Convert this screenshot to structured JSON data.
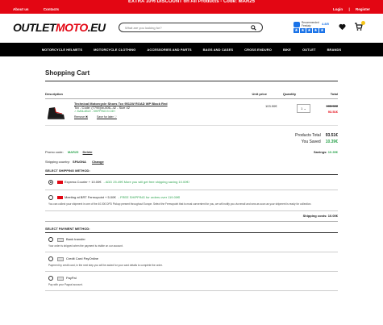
{
  "promo_bar": {
    "text": "EXTRA 10% DISCOUNT on All Products - Code: MAR25"
  },
  "top_bar": {
    "about": "About us",
    "contacts": "Contacts",
    "login": "Login",
    "sep": "|",
    "register": "Register"
  },
  "header": {
    "logo_outlet": "OUTLET",
    "logo_moto": "MOTO",
    "logo_eu": ".EU",
    "search_placeholder": "What are you looking for?",
    "rating_text": "Recommended Feedaty",
    "rating_score": "4.8/5"
  },
  "nav": [
    "MOTORCYCLE HELMETS",
    "MOTORCYCLE CLOTHING",
    "ACCESSORIES AND PARTS",
    "BAGS AND CASES",
    "CROSS ENDURO",
    "BIKE",
    "OUTLET",
    "BRANDS"
  ],
  "cart": {
    "title": "Shopping Cart",
    "col_description": "Description",
    "col_unit_price": "Unit price",
    "col_quantity": "Quantity",
    "col_total": "Total",
    "item": {
      "title": "Technical Motorcycle Shoes Tcx 9511W ROAD WP Black Red",
      "code": "Tcx - Code: (7795)/w-606--42 - Size 42",
      "availability": "✓ AVAILABLE - SHIPPING IN 24H",
      "remove": "Remove ✖",
      "save_later": "Save for later ♡",
      "unit_price": "103.90€",
      "quantity": "1",
      "old_total": "103.90€",
      "new_total": "93.51€"
    },
    "products_total_label": "Products Total",
    "products_total": "93.51€",
    "saved_label": "You Saved",
    "saved": "10.39€"
  },
  "promo": {
    "label": "Promo code:",
    "code": "MAR25",
    "delete": "Delete",
    "savings_label": "Savings:",
    "savings": "10.39€"
  },
  "shipping": {
    "country_label": "Shipping country:",
    "country": "SPAGNA",
    "change": "Change",
    "title": "SELECT SHIPPING METHOD:",
    "option1_name": "Express Courier + 10.00€",
    "option1_note": "- ADD 25.49€ More you will get free shipping saving 10.00€!",
    "option2_name": "Meeting at BRT Fermopoint + 5.00€",
    "option2_note": "- FREE SHIPPING for orders over 119.00€!",
    "option2_desc": "You can collect your shipment in one of the 40.000 DPD Pickup present throughout Europe. Select the Fermopoint that is most convenient for you, we will notify you via email and sms as soon as your shipment is ready for collection.",
    "cost_label": "Shipping costs:",
    "cost": "10.00€"
  },
  "payment": {
    "title": "SELECT PAYMENT METHOD:",
    "options": [
      {
        "name": "Bank transfer",
        "desc": "Your order is shipped when the payment is visible on our account."
      },
      {
        "name": "Credit Card PayOnline",
        "desc": "Payment by credit card, in the next step you will be asked for your card details to complete the order."
      },
      {
        "name": "PayPal",
        "desc": "Pay with your Paypal account."
      }
    ]
  }
}
